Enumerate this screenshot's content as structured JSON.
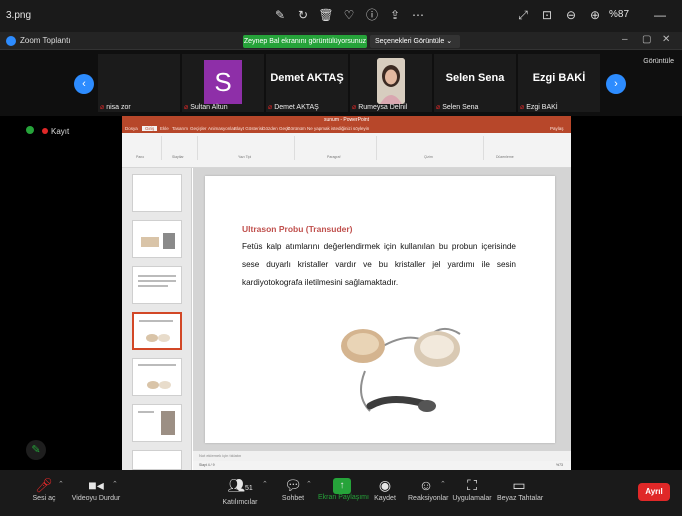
{
  "viewer": {
    "filename": "3.png",
    "zoom_level": "%87"
  },
  "zoom": {
    "app_name": "Zoom Toplantı",
    "share_banner": "Zeynep Bal ekranını görüntülüyorsunuz",
    "view_options": "Seçenekleri Görüntüle",
    "gallery_label": "Görüntüle"
  },
  "participants": [
    {
      "name": "nisa zor",
      "display": "",
      "avatar": "none"
    },
    {
      "name": "Sultan Altun",
      "display": "S",
      "avatar": "letter"
    },
    {
      "name": "Demet AKTAŞ",
      "display": "Demet AKTAŞ",
      "avatar": "name"
    },
    {
      "name": "Rumeysa Delnil",
      "display": "",
      "avatar": "photo"
    },
    {
      "name": "Selen Sena",
      "display": "Selen Sena",
      "avatar": "name"
    },
    {
      "name": "Ezgi BAKİ",
      "display": "Ezgi BAKİ",
      "avatar": "name"
    }
  ],
  "recording": {
    "label": "Kayıt"
  },
  "powerpoint": {
    "title": "sunum - PowerPoint",
    "tabs": [
      "Dosya",
      "Giriş",
      "Ekle",
      "Tasarım",
      "Geçişler",
      "Animasyonlar",
      "Slayt Gösterisi",
      "Gözden Geçir",
      "Görünüm",
      "Ne yapmak istediğinizi söyleyin"
    ],
    "share_label": "Paylaş",
    "ribbon_groups": [
      "Pano",
      "Slaytlar",
      "Yazı Tipi",
      "Paragraf",
      "Çizim",
      "Düzenleme"
    ],
    "notes_placeholder": "Not eklemek için tıklatın",
    "status": "Slayt 4 / 9",
    "zoom": "%73"
  },
  "slide": {
    "heading": "Ultrason Probu (Transuder)",
    "body": "Fetüs kalp atımlarını değerlendirmek için kullanılan bu probun içerisinde sese duyarlı kristaller vardır ve bu kristaller jel yardımı ile sesin kardiyotokografa iletilmesini sağlamaktadır."
  },
  "toolbar": {
    "mute": "Sesi aç",
    "video": "Videoyu Durdur",
    "participants": "Katılımcılar",
    "participants_count": "51",
    "chat": "Sohbet",
    "share": "Ekran Paylaşımı",
    "record": "Kaydet",
    "reactions": "Reaksiyonlar",
    "apps": "Uygulamalar",
    "whiteboard": "Beyaz Tahtalar",
    "leave": "Ayrıl"
  },
  "colors": {
    "zoom_blue": "#2d8cff",
    "share_green": "#26a33a",
    "leave_red": "#e02828",
    "ppt_orange": "#b7472a",
    "slide_heading": "#c0504d"
  }
}
